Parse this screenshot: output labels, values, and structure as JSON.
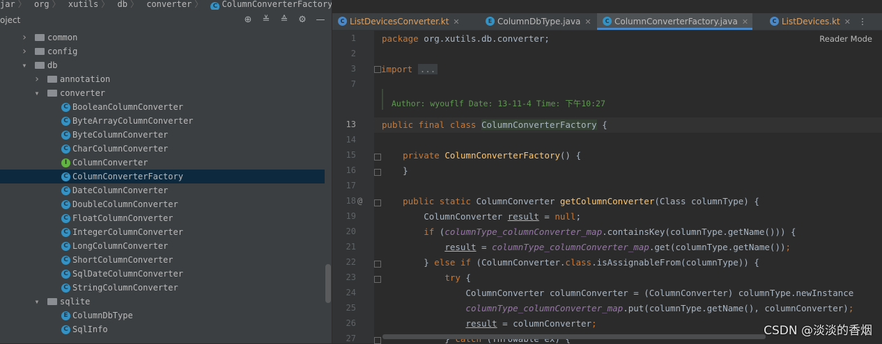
{
  "breadcrumb": [
    "jar",
    "org",
    "xutils",
    "db",
    "converter",
    "ColumnConverterFactory"
  ],
  "project_panel": {
    "title": "oject",
    "tools": [
      "target-icon",
      "expand-icon",
      "collapse-icon",
      "gear-icon",
      "minimize-icon"
    ],
    "tree": [
      {
        "label": "common",
        "type": "folder",
        "depth": 1,
        "expanded": false
      },
      {
        "label": "config",
        "type": "folder",
        "depth": 1,
        "expanded": false
      },
      {
        "label": "db",
        "type": "folder",
        "depth": 1,
        "expanded": true
      },
      {
        "label": "annotation",
        "type": "folder",
        "depth": 2,
        "expanded": false
      },
      {
        "label": "converter",
        "type": "folder",
        "depth": 2,
        "expanded": true
      },
      {
        "label": "BooleanColumnConverter",
        "type": "class",
        "depth": 3
      },
      {
        "label": "ByteArrayColumnConverter",
        "type": "class",
        "depth": 3
      },
      {
        "label": "ByteColumnConverter",
        "type": "class",
        "depth": 3
      },
      {
        "label": "CharColumnConverter",
        "type": "class",
        "depth": 3
      },
      {
        "label": "ColumnConverter",
        "type": "interface",
        "depth": 3
      },
      {
        "label": "ColumnConverterFactory",
        "type": "class",
        "depth": 3,
        "selected": true
      },
      {
        "label": "DateColumnConverter",
        "type": "class",
        "depth": 3
      },
      {
        "label": "DoubleColumnConverter",
        "type": "class",
        "depth": 3
      },
      {
        "label": "FloatColumnConverter",
        "type": "class",
        "depth": 3
      },
      {
        "label": "IntegerColumnConverter",
        "type": "class",
        "depth": 3
      },
      {
        "label": "LongColumnConverter",
        "type": "class",
        "depth": 3
      },
      {
        "label": "ShortColumnConverter",
        "type": "class",
        "depth": 3
      },
      {
        "label": "SqlDateColumnConverter",
        "type": "class",
        "depth": 3
      },
      {
        "label": "StringColumnConverter",
        "type": "class",
        "depth": 3
      },
      {
        "label": "sqlite",
        "type": "folder",
        "depth": 2,
        "expanded": true
      },
      {
        "label": "ColumnDbType",
        "type": "enum",
        "depth": 3
      },
      {
        "label": "SqlInfo",
        "type": "class",
        "depth": 3
      }
    ]
  },
  "tabs": [
    {
      "label": "ListDevicesConverter.kt",
      "kind": "kotlin",
      "active": false
    },
    {
      "label": "ColumnDbType.java",
      "kind": "enum",
      "active": false
    },
    {
      "label": "ColumnConverterFactory.java",
      "kind": "class",
      "active": true
    },
    {
      "label": "ListDevices.kt",
      "kind": "kotlin",
      "active": false
    }
  ],
  "tabs_overflow": "⋮",
  "editor": {
    "reader_mode": "Reader Mode",
    "lines": [
      {
        "n": "1"
      },
      {
        "n": "2"
      },
      {
        "n": "3"
      },
      {
        "n": "7"
      },
      {
        "n": ""
      },
      {
        "n": "13",
        "current": true
      },
      {
        "n": "14"
      },
      {
        "n": "15"
      },
      {
        "n": "16"
      },
      {
        "n": "17"
      },
      {
        "n": "18"
      },
      {
        "n": "19"
      },
      {
        "n": "20"
      },
      {
        "n": "21"
      },
      {
        "n": "22"
      },
      {
        "n": "23"
      },
      {
        "n": "24"
      },
      {
        "n": "25"
      },
      {
        "n": "26"
      },
      {
        "n": "27"
      }
    ],
    "comment": "Author: wyouflf Date: 13-11-4 Time: 下午10:27",
    "gutter_at": "@"
  },
  "watermark": "CSDN @淡淡的香烟",
  "colors": {
    "selection": "#0d293e",
    "accent": "#4a88c7",
    "keyword": "#cc7832",
    "function": "#ffc66d",
    "field": "#9876aa",
    "comment": "#629755"
  }
}
